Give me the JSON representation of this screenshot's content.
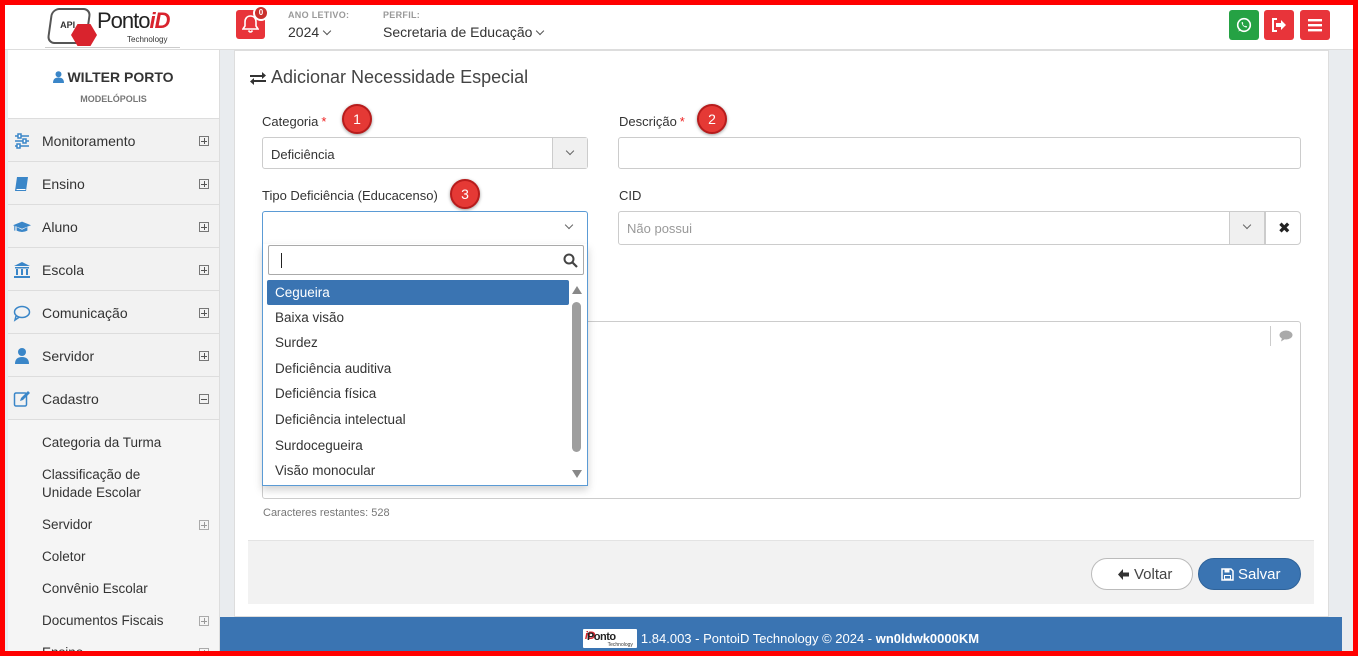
{
  "header": {
    "logo_api": "API",
    "logo_brand_a": "Ponto",
    "logo_brand_b": "iD",
    "logo_tech": "Technology",
    "notifications": "0",
    "year_label": "ANO LETIVO:",
    "year_value": "2024",
    "profile_label": "PERFIL:",
    "profile_value": "Secretaria de Educação",
    "colors": {
      "whatsapp": "#25a244",
      "logout": "#e8343a",
      "menu": "#e8343a"
    }
  },
  "user": {
    "name": "WILTER PORTO",
    "city": "MODELÓPOLIS"
  },
  "sidebar": {
    "items": [
      {
        "label": "Monitoramento",
        "icon": "sliders-icon"
      },
      {
        "label": "Ensino",
        "icon": "book-icon"
      },
      {
        "label": "Aluno",
        "icon": "graduation-cap-icon"
      },
      {
        "label": "Escola",
        "icon": "institution-icon"
      },
      {
        "label": "Comunicação",
        "icon": "chat-bubble-icon"
      },
      {
        "label": "Servidor",
        "icon": "user-icon"
      },
      {
        "label": "Cadastro",
        "icon": "edit-icon"
      }
    ],
    "subitems": [
      {
        "label": "Categoria da Turma"
      },
      {
        "label": "Classificação de Unidade Escolar"
      },
      {
        "label": "Servidor"
      },
      {
        "label": "Coletor"
      },
      {
        "label": "Convênio Escolar"
      },
      {
        "label": "Documentos Fiscais"
      },
      {
        "label": "Ensino"
      }
    ]
  },
  "form": {
    "title": "Adicionar Necessidade Especial",
    "categoria_label": "Categoria",
    "categoria_value": "Deficiência",
    "descricao_label": "Descrição",
    "descricao_value": "",
    "tipo_label": "Tipo Deficiência (Educacenso)",
    "tipo_value": "",
    "cid_label": "CID",
    "cid_placeholder": "Não possui",
    "cid_clear": "✖",
    "required_mark": "*",
    "chars_remaining": "Caracteres restantes: 528",
    "back_label": "Voltar",
    "save_label": "Salvar",
    "markers": [
      "1",
      "2",
      "3"
    ]
  },
  "dropdown": {
    "search_value": "",
    "options": [
      "Cegueira",
      "Baixa visão",
      "Surdez",
      "Deficiência auditiva",
      "Deficiência física",
      "Deficiência intelectual",
      "Surdocegueira",
      "Visão monocular"
    ],
    "selected_index": 0
  },
  "footer": {
    "text": "1.84.003 - PontoiD Technology © 2024 - ",
    "build": "wn0ldwk0000KM",
    "mini_brand_a": "Ponto",
    "mini_brand_b": "iD",
    "mini_tech": "Technology"
  }
}
